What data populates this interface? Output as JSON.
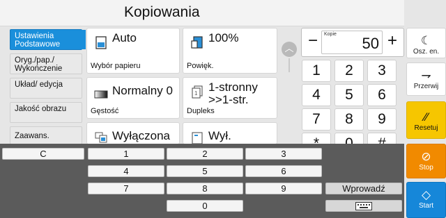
{
  "title": "Kopiowania",
  "nav": [
    {
      "label": "Ustawienia Podstawowe",
      "active": true
    },
    {
      "label": "Oryg./pap./ Wykończenie"
    },
    {
      "label": "Układ/ edycja"
    },
    {
      "label": "Jakość obrazu"
    },
    {
      "label": "Zaawans."
    }
  ],
  "cards": {
    "paper": {
      "value": "Auto",
      "label": "Wybór papieru",
      "icon": "paper-tray-icon"
    },
    "zoom": {
      "value": "100%",
      "label": "Powięk.",
      "icon": "zoom-page-icon"
    },
    "density": {
      "value": "Normalny 0",
      "label": "Gęstość",
      "icon": "density-bar-icon"
    },
    "duplex": {
      "value": "1-stronny >>1-str.",
      "label": "Dupleks",
      "icon": "duplex-page-icon"
    },
    "combine": {
      "value": "Wyłączona",
      "icon": "combine-pages-icon"
    },
    "staple": {
      "value": "Wył.",
      "icon": "staple-icon"
    }
  },
  "copies": {
    "label": "Kopie",
    "value": "50",
    "minus": "−",
    "plus": "+"
  },
  "keypad": [
    "1",
    "2",
    "3",
    "4",
    "5",
    "6",
    "7",
    "8",
    "9",
    "*",
    "0",
    "#"
  ],
  "side": {
    "sleep": {
      "label": "Osz. en.",
      "icon": "moon-icon"
    },
    "interrupt": {
      "label": "Przerwij",
      "icon": "interrupt-icon"
    },
    "reset": {
      "label": "Resetuj",
      "icon": "reset-icon"
    },
    "stop": {
      "label": "Stop",
      "icon": "stop-icon"
    },
    "start": {
      "label": "Start",
      "icon": "start-icon"
    }
  },
  "keyboard": {
    "clear": "C",
    "rows": [
      [
        "1",
        "2",
        "3"
      ],
      [
        "4",
        "5",
        "6"
      ],
      [
        "7",
        "8",
        "9"
      ],
      [
        "0"
      ]
    ],
    "enter": "Wprowadź",
    "keyboard_icon": "keyboard-icon"
  },
  "colors": {
    "accent_blue": "#1a8fdb",
    "stop_orange": "#f18a00",
    "reset_yellow": "#f6c600",
    "start_blue": "#1687d9"
  }
}
